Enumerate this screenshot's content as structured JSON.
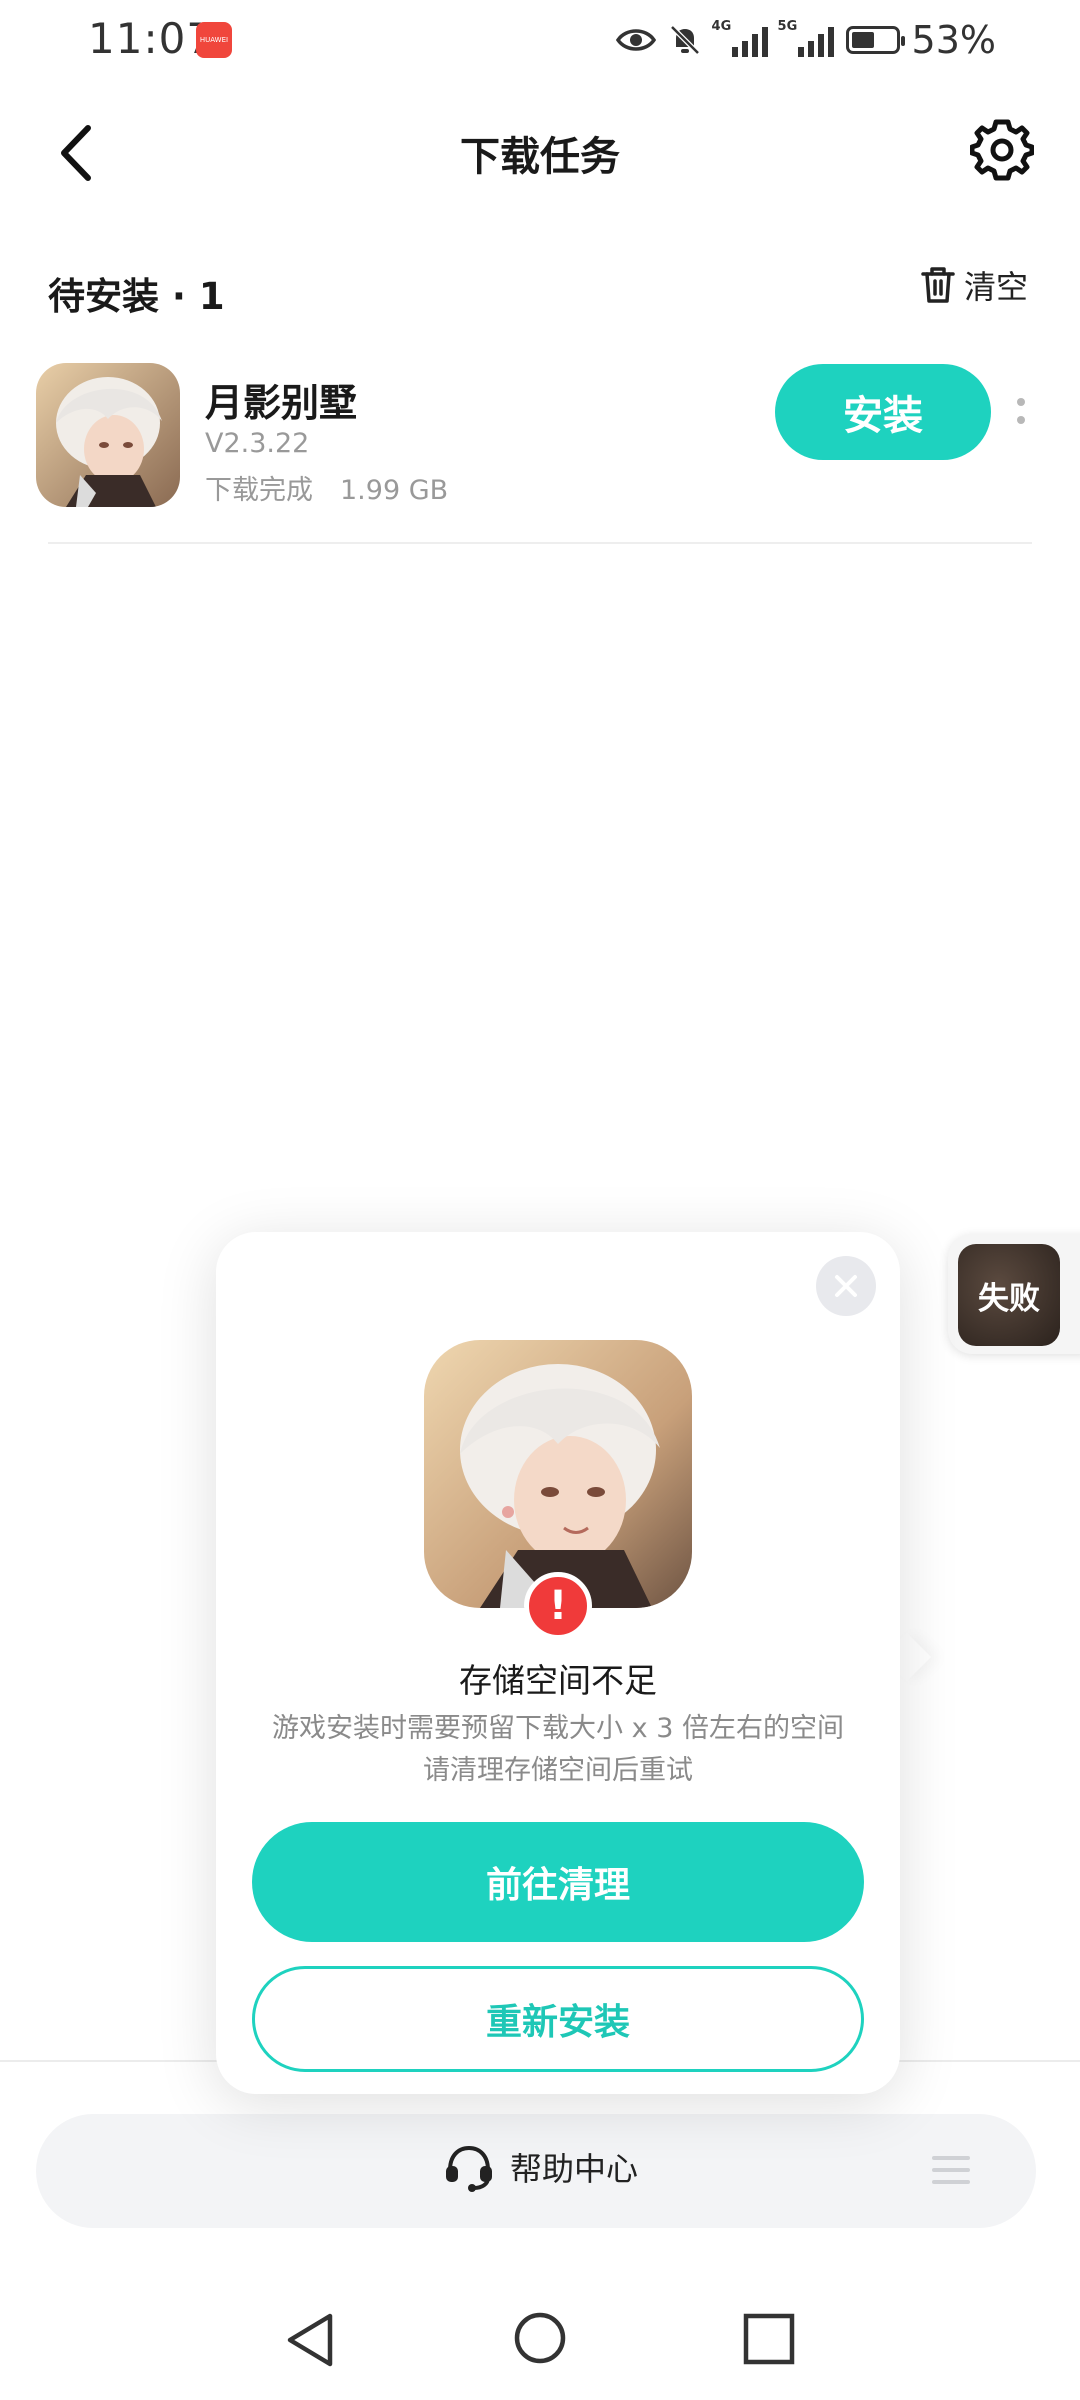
{
  "status_bar": {
    "time": "11:07",
    "battery": "53%",
    "battery_level": 0.53,
    "signal_1": "4G",
    "signal_2": "5G"
  },
  "header": {
    "title": "下载任务"
  },
  "section": {
    "title": "待安装 · 1",
    "clear_label": "清空"
  },
  "download_item": {
    "name": "月影别墅",
    "version": "V2.3.22",
    "status": "下载完成　1.99 GB",
    "install_label": "安装"
  },
  "popup": {
    "title": "存储空间不足",
    "desc_line1": "游戏安装时需要预留下载大小 x 3 倍左右的空间",
    "desc_line2": "请清理存储空间后重试",
    "primary_button": "前往清理",
    "secondary_button": "重新安装",
    "warning_glyph": "!"
  },
  "side_float": {
    "label": "失败"
  },
  "bottom_bar": {
    "help_label": "帮助中心"
  },
  "colors": {
    "accent": "#1ed2bf",
    "error": "#f03a3a"
  }
}
